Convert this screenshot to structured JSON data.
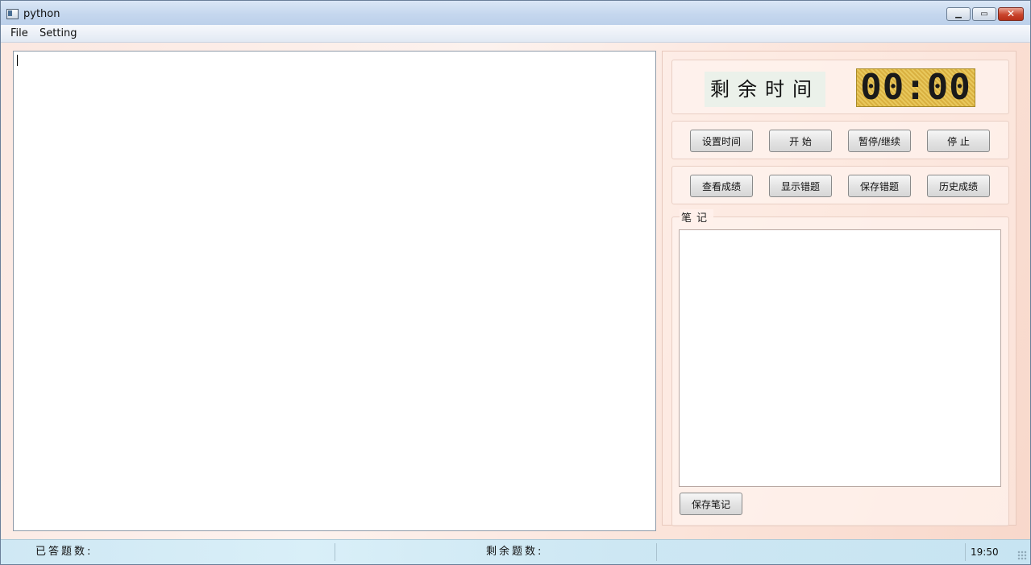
{
  "window": {
    "title": "python",
    "controls": {
      "minimize_icon": "minimize-icon",
      "maximize_icon": "maximize-icon",
      "close_icon": "close-icon"
    }
  },
  "menubar": {
    "items": [
      "File",
      "Setting"
    ]
  },
  "timer": {
    "label": "剩余时间",
    "display": "00:00"
  },
  "controls": {
    "buttons": [
      "设置时间",
      "开 始",
      "暂停/继续",
      "停 止"
    ]
  },
  "tools": {
    "buttons": [
      "查看成绩",
      "显示错题",
      "保存错题",
      "历史成绩"
    ]
  },
  "notes": {
    "title": "笔记",
    "save_button": "保存笔记"
  },
  "statusbar": {
    "answered": "已答题数:",
    "remaining": "剩余题数:",
    "time": "19:50"
  },
  "colors": {
    "lcd_background": "#e0bd4f",
    "status_background": "#d3ebf6",
    "panel_background": "#fbe8e1"
  }
}
